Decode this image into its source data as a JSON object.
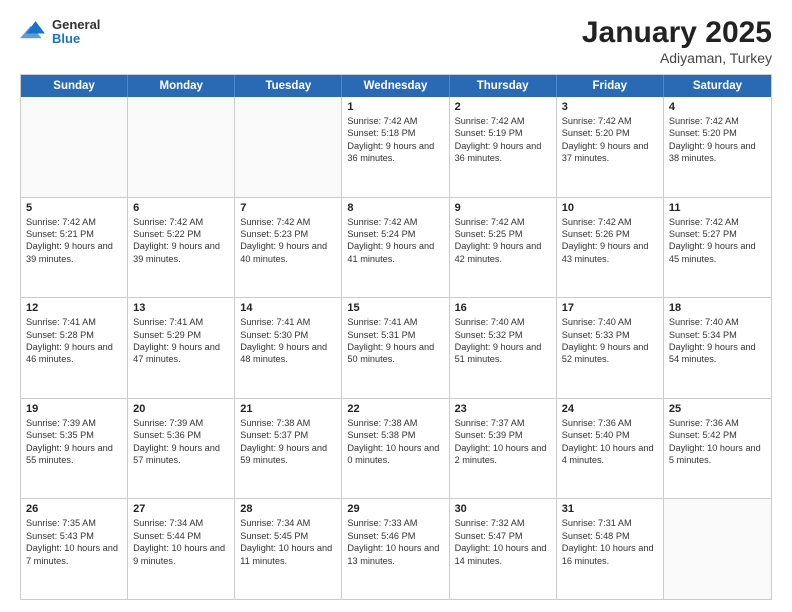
{
  "header": {
    "logo_general": "General",
    "logo_blue": "Blue",
    "month_title": "January 2025",
    "subtitle": "Adiyaman, Turkey"
  },
  "calendar": {
    "days_of_week": [
      "Sunday",
      "Monday",
      "Tuesday",
      "Wednesday",
      "Thursday",
      "Friday",
      "Saturday"
    ],
    "rows": [
      {
        "cells": [
          {
            "day": "",
            "content": "",
            "empty": true
          },
          {
            "day": "",
            "content": "",
            "empty": true
          },
          {
            "day": "",
            "content": "",
            "empty": true
          },
          {
            "day": "1",
            "content": "Sunrise: 7:42 AM\nSunset: 5:18 PM\nDaylight: 9 hours\nand 36 minutes."
          },
          {
            "day": "2",
            "content": "Sunrise: 7:42 AM\nSunset: 5:19 PM\nDaylight: 9 hours\nand 36 minutes."
          },
          {
            "day": "3",
            "content": "Sunrise: 7:42 AM\nSunset: 5:20 PM\nDaylight: 9 hours\nand 37 minutes."
          },
          {
            "day": "4",
            "content": "Sunrise: 7:42 AM\nSunset: 5:20 PM\nDaylight: 9 hours\nand 38 minutes."
          }
        ]
      },
      {
        "cells": [
          {
            "day": "5",
            "content": "Sunrise: 7:42 AM\nSunset: 5:21 PM\nDaylight: 9 hours\nand 39 minutes."
          },
          {
            "day": "6",
            "content": "Sunrise: 7:42 AM\nSunset: 5:22 PM\nDaylight: 9 hours\nand 39 minutes."
          },
          {
            "day": "7",
            "content": "Sunrise: 7:42 AM\nSunset: 5:23 PM\nDaylight: 9 hours\nand 40 minutes."
          },
          {
            "day": "8",
            "content": "Sunrise: 7:42 AM\nSunset: 5:24 PM\nDaylight: 9 hours\nand 41 minutes."
          },
          {
            "day": "9",
            "content": "Sunrise: 7:42 AM\nSunset: 5:25 PM\nDaylight: 9 hours\nand 42 minutes."
          },
          {
            "day": "10",
            "content": "Sunrise: 7:42 AM\nSunset: 5:26 PM\nDaylight: 9 hours\nand 43 minutes."
          },
          {
            "day": "11",
            "content": "Sunrise: 7:42 AM\nSunset: 5:27 PM\nDaylight: 9 hours\nand 45 minutes."
          }
        ]
      },
      {
        "cells": [
          {
            "day": "12",
            "content": "Sunrise: 7:41 AM\nSunset: 5:28 PM\nDaylight: 9 hours\nand 46 minutes."
          },
          {
            "day": "13",
            "content": "Sunrise: 7:41 AM\nSunset: 5:29 PM\nDaylight: 9 hours\nand 47 minutes."
          },
          {
            "day": "14",
            "content": "Sunrise: 7:41 AM\nSunset: 5:30 PM\nDaylight: 9 hours\nand 48 minutes."
          },
          {
            "day": "15",
            "content": "Sunrise: 7:41 AM\nSunset: 5:31 PM\nDaylight: 9 hours\nand 50 minutes."
          },
          {
            "day": "16",
            "content": "Sunrise: 7:40 AM\nSunset: 5:32 PM\nDaylight: 9 hours\nand 51 minutes."
          },
          {
            "day": "17",
            "content": "Sunrise: 7:40 AM\nSunset: 5:33 PM\nDaylight: 9 hours\nand 52 minutes."
          },
          {
            "day": "18",
            "content": "Sunrise: 7:40 AM\nSunset: 5:34 PM\nDaylight: 9 hours\nand 54 minutes."
          }
        ]
      },
      {
        "cells": [
          {
            "day": "19",
            "content": "Sunrise: 7:39 AM\nSunset: 5:35 PM\nDaylight: 9 hours\nand 55 minutes."
          },
          {
            "day": "20",
            "content": "Sunrise: 7:39 AM\nSunset: 5:36 PM\nDaylight: 9 hours\nand 57 minutes."
          },
          {
            "day": "21",
            "content": "Sunrise: 7:38 AM\nSunset: 5:37 PM\nDaylight: 9 hours\nand 59 minutes."
          },
          {
            "day": "22",
            "content": "Sunrise: 7:38 AM\nSunset: 5:38 PM\nDaylight: 10 hours\nand 0 minutes."
          },
          {
            "day": "23",
            "content": "Sunrise: 7:37 AM\nSunset: 5:39 PM\nDaylight: 10 hours\nand 2 minutes."
          },
          {
            "day": "24",
            "content": "Sunrise: 7:36 AM\nSunset: 5:40 PM\nDaylight: 10 hours\nand 4 minutes."
          },
          {
            "day": "25",
            "content": "Sunrise: 7:36 AM\nSunset: 5:42 PM\nDaylight: 10 hours\nand 5 minutes."
          }
        ]
      },
      {
        "cells": [
          {
            "day": "26",
            "content": "Sunrise: 7:35 AM\nSunset: 5:43 PM\nDaylight: 10 hours\nand 7 minutes."
          },
          {
            "day": "27",
            "content": "Sunrise: 7:34 AM\nSunset: 5:44 PM\nDaylight: 10 hours\nand 9 minutes."
          },
          {
            "day": "28",
            "content": "Sunrise: 7:34 AM\nSunset: 5:45 PM\nDaylight: 10 hours\nand 11 minutes."
          },
          {
            "day": "29",
            "content": "Sunrise: 7:33 AM\nSunset: 5:46 PM\nDaylight: 10 hours\nand 13 minutes."
          },
          {
            "day": "30",
            "content": "Sunrise: 7:32 AM\nSunset: 5:47 PM\nDaylight: 10 hours\nand 14 minutes."
          },
          {
            "day": "31",
            "content": "Sunrise: 7:31 AM\nSunset: 5:48 PM\nDaylight: 10 hours\nand 16 minutes."
          },
          {
            "day": "",
            "content": "",
            "empty": true
          }
        ]
      }
    ]
  }
}
